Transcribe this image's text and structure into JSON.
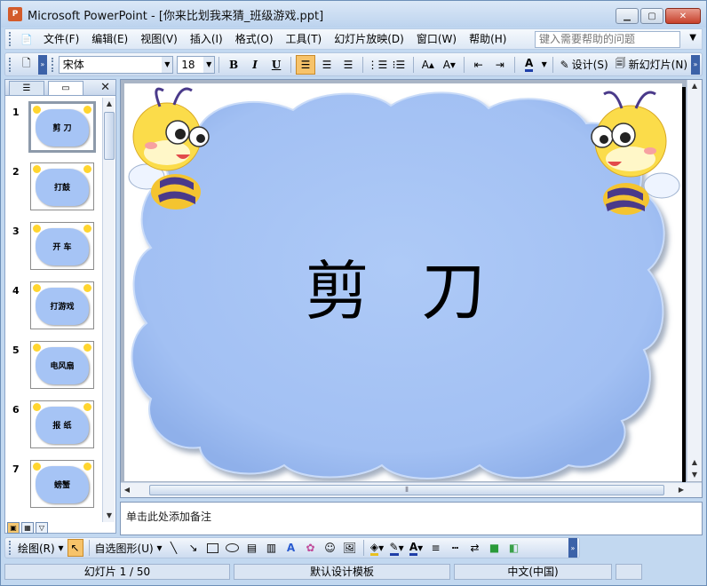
{
  "window": {
    "title": "Microsoft PowerPoint - [你来比划我来猜_班级游戏.ppt]",
    "app_icon": "powerpoint-icon",
    "controls": [
      "minimize-icon",
      "maximize-icon",
      "close-icon"
    ]
  },
  "menubar": {
    "items": [
      "文件(F)",
      "编辑(E)",
      "视图(V)",
      "插入(I)",
      "格式(O)",
      "工具(T)",
      "幻灯片放映(D)",
      "窗口(W)",
      "帮助(H)"
    ],
    "help_placeholder": "键入需要帮助的问题"
  },
  "format_toolbar": {
    "font_name": "宋体",
    "font_size": "18",
    "bold": "B",
    "italic": "I",
    "underline": "U",
    "design_label": "设计(S)",
    "new_slide_label": "新幻灯片(N)",
    "active_alignment": "align-left"
  },
  "left_panel": {
    "tabs": [
      "outline-tab",
      "slides-tab"
    ],
    "active_tab": "slides-tab",
    "slides": [
      {
        "number": "1",
        "text": "剪 刀",
        "selected": true
      },
      {
        "number": "2",
        "text": "打鼓"
      },
      {
        "number": "3",
        "text": "开 车"
      },
      {
        "number": "4",
        "text": "打游戏"
      },
      {
        "number": "5",
        "text": "电风扇"
      },
      {
        "number": "6",
        "text": "报 纸"
      },
      {
        "number": "7",
        "text": "螃蟹"
      }
    ]
  },
  "slide": {
    "title": "剪 刀",
    "background_shape_color": "#a6c4f5",
    "decorations": [
      "bee-left",
      "bee-right"
    ]
  },
  "notes": {
    "placeholder": "单击此处添加备注"
  },
  "drawing_toolbar": {
    "draw_label": "绘图(R)",
    "autoshapes_label": "自选图形(U)"
  },
  "status_bar": {
    "slide_info": "幻灯片 1 / 50",
    "template": "默认设计模板",
    "language": "中文(中国)"
  }
}
